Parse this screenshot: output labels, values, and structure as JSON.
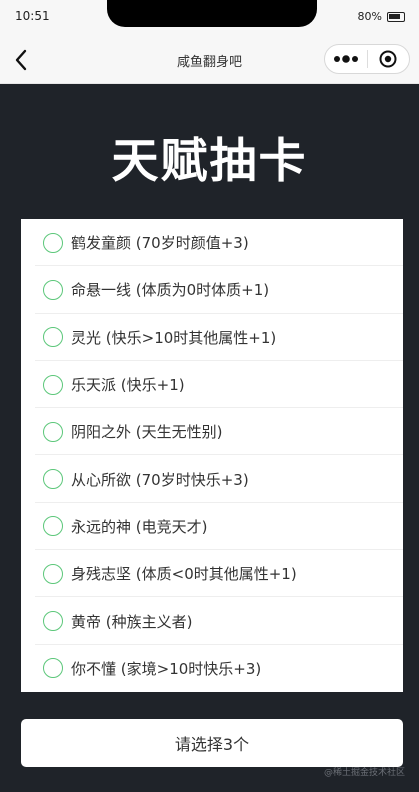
{
  "status_bar": {
    "time": "10:51",
    "battery": "80%"
  },
  "nav": {
    "title": "咸鱼翻身吧"
  },
  "page": {
    "title": "天赋抽卡"
  },
  "talents": [
    {
      "label": "鹤发童颜 (70岁时颜值+3)"
    },
    {
      "label": "命悬一线 (体质为0时体质+1)"
    },
    {
      "label": "灵光 (快乐>10时其他属性+1)"
    },
    {
      "label": "乐天派 (快乐+1)"
    },
    {
      "label": "阴阳之外 (天生无性别)"
    },
    {
      "label": "从心所欲 (70岁时快乐+3)"
    },
    {
      "label": "永远的神 (电竞天才)"
    },
    {
      "label": "身残志坚 (体质<0时其他属性+1)"
    },
    {
      "label": "黄帝 (种族主义者)"
    },
    {
      "label": "你不懂 (家境>10时快乐+3)"
    }
  ],
  "submit": {
    "label": "请选择3个"
  },
  "watermark": "@稀土掘金技术社区",
  "colors": {
    "background": "#1f2329",
    "radio": "#5cc77a"
  }
}
